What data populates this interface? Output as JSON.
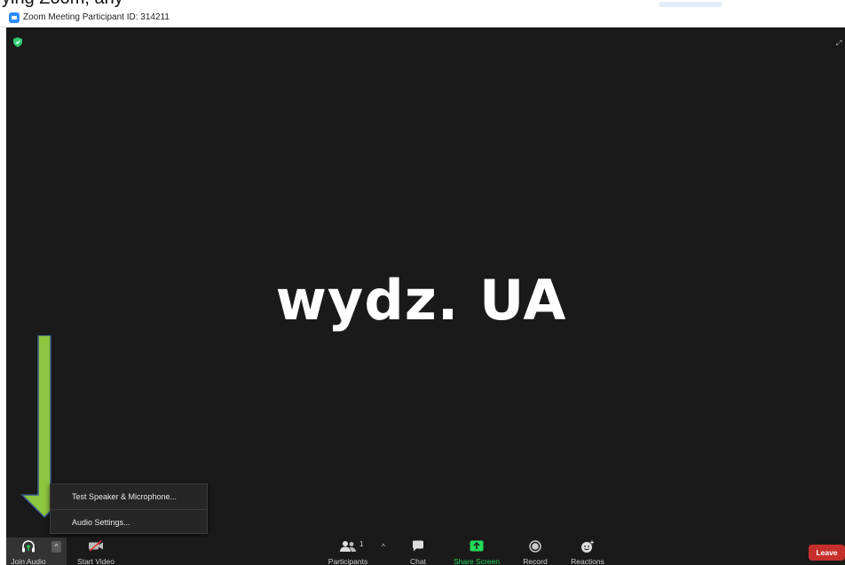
{
  "window": {
    "title": "Zoom Meeting Participant ID: 314211"
  },
  "caption_fragment": "ying Zoom, any",
  "stage": {
    "participant_name": "wydz. UA"
  },
  "audio_menu": {
    "items": [
      {
        "label": "Test Speaker & Microphone..."
      },
      {
        "label": "Audio Settings..."
      }
    ]
  },
  "toolbar": {
    "join_audio": "Join Audio",
    "start_video": "Start Video",
    "participants": "Participants",
    "participants_count": "1",
    "chat": "Chat",
    "share_screen": "Share Screen",
    "record": "Record",
    "reactions": "Reactions",
    "leave": "Leave"
  },
  "colors": {
    "stage_bg": "#1a1a1a",
    "share_green": "#23d959",
    "leave_red": "#c5302c",
    "arrow_green": "#8dc63f",
    "arrow_border": "#3a5a8c",
    "shield_green": "#2ecc71"
  },
  "icons": {
    "title": "zoom-logo-icon",
    "security": "shield-icon",
    "expand": "expand-icon",
    "join_audio": "headphones-icon",
    "start_video": "video-off-icon",
    "participants": "people-icon",
    "chat": "chat-bubble-icon",
    "share_screen": "share-screen-icon",
    "record": "record-icon",
    "reactions": "smiley-icon"
  }
}
